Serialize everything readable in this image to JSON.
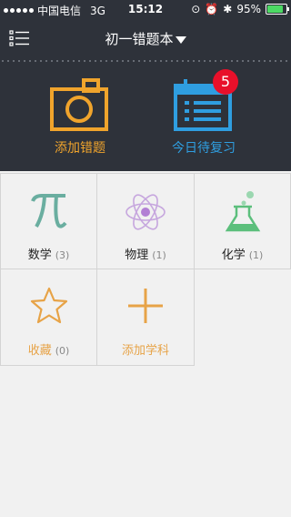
{
  "status": {
    "carrier": "中国电信",
    "network": "3G",
    "time": "15:12",
    "battery": "95%",
    "battery_level": 0.95
  },
  "nav": {
    "title": "初一错题本"
  },
  "actions": {
    "add_wrong": {
      "label": "添加错题",
      "color": "#f0a42c"
    },
    "review": {
      "label": "今日待复习",
      "badge": "5",
      "color": "#2f9ee0"
    }
  },
  "subjects": [
    {
      "name": "数学",
      "count": "(3)"
    },
    {
      "name": "物理",
      "count": "(1)"
    },
    {
      "name": "化学",
      "count": "(1)"
    }
  ],
  "favorites": {
    "name": "收藏",
    "count": "(0)"
  },
  "add_subject": {
    "label": "添加学科"
  }
}
